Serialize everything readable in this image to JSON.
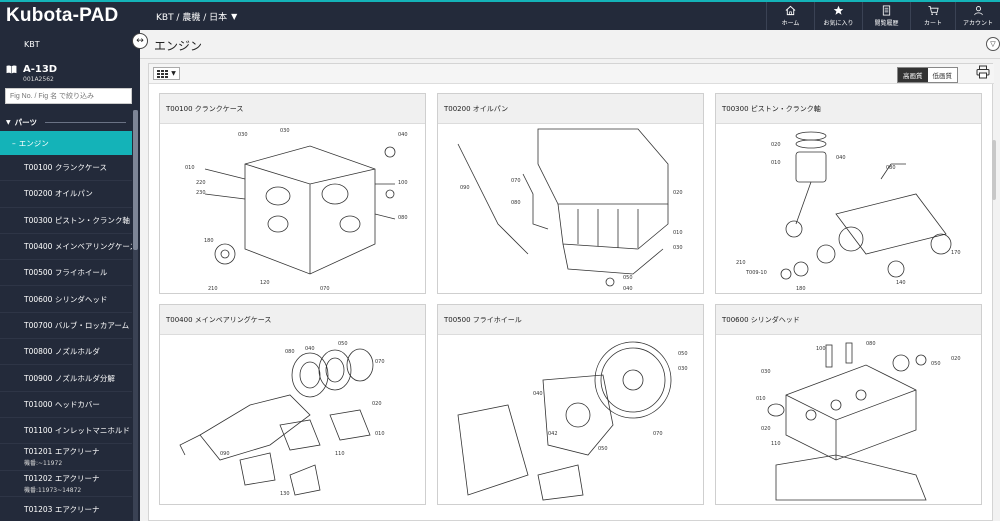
{
  "header": {
    "logo": "Kubota-PAD",
    "region": "KBT / 農機 / 日本",
    "nav": [
      {
        "label": "ホーム",
        "icon": "home-icon"
      },
      {
        "label": "お気に入り",
        "icon": "star-icon"
      },
      {
        "label": "閲覧履歴",
        "icon": "history-icon"
      },
      {
        "label": "カート",
        "icon": "cart-icon"
      },
      {
        "label": "アカウント",
        "icon": "account-icon"
      }
    ]
  },
  "sidebar": {
    "kbt": "KBT",
    "model_name": "A-13D",
    "model_code": "001A2562",
    "search_placeholder": "Fig No. / Fig 名 で絞り込み",
    "section": "パーツ",
    "active": "エンジン",
    "items": [
      {
        "label": "T00100 クランクケース"
      },
      {
        "label": "T00200 オイルパン"
      },
      {
        "label": "T00300 ピストン・クランク軸"
      },
      {
        "label": "T00400 メインベアリングケース"
      },
      {
        "label": "T00500 フライホイール"
      },
      {
        "label": "T00600 シリンダヘッド"
      },
      {
        "label": "T00700 バルブ・ロッカアーム"
      },
      {
        "label": "T00800 ノズルホルダ"
      },
      {
        "label": "T00900 ノズルホルダ分解"
      },
      {
        "label": "T01000 ヘッドカバー"
      },
      {
        "label": "T01100 インレットマニホルド"
      },
      {
        "label": "T01201 エアクリーナ",
        "sub": "機番:~11972"
      },
      {
        "label": "T01202 エアクリーナ",
        "sub": "機番:11973~14872"
      },
      {
        "label": "T01203 エアクリーナ"
      }
    ]
  },
  "main": {
    "title": "エンジン",
    "quality_high": "高画質",
    "quality_low": "低画質",
    "cards": [
      {
        "title": "T00100 クランクケース"
      },
      {
        "title": "T00200 オイルパン"
      },
      {
        "title": "T00300 ピストン・クランク軸"
      },
      {
        "title": "T00400 メインベアリングケース"
      },
      {
        "title": "T00500 フライホイール"
      },
      {
        "title": "T00600 シリンダヘッド"
      }
    ]
  }
}
